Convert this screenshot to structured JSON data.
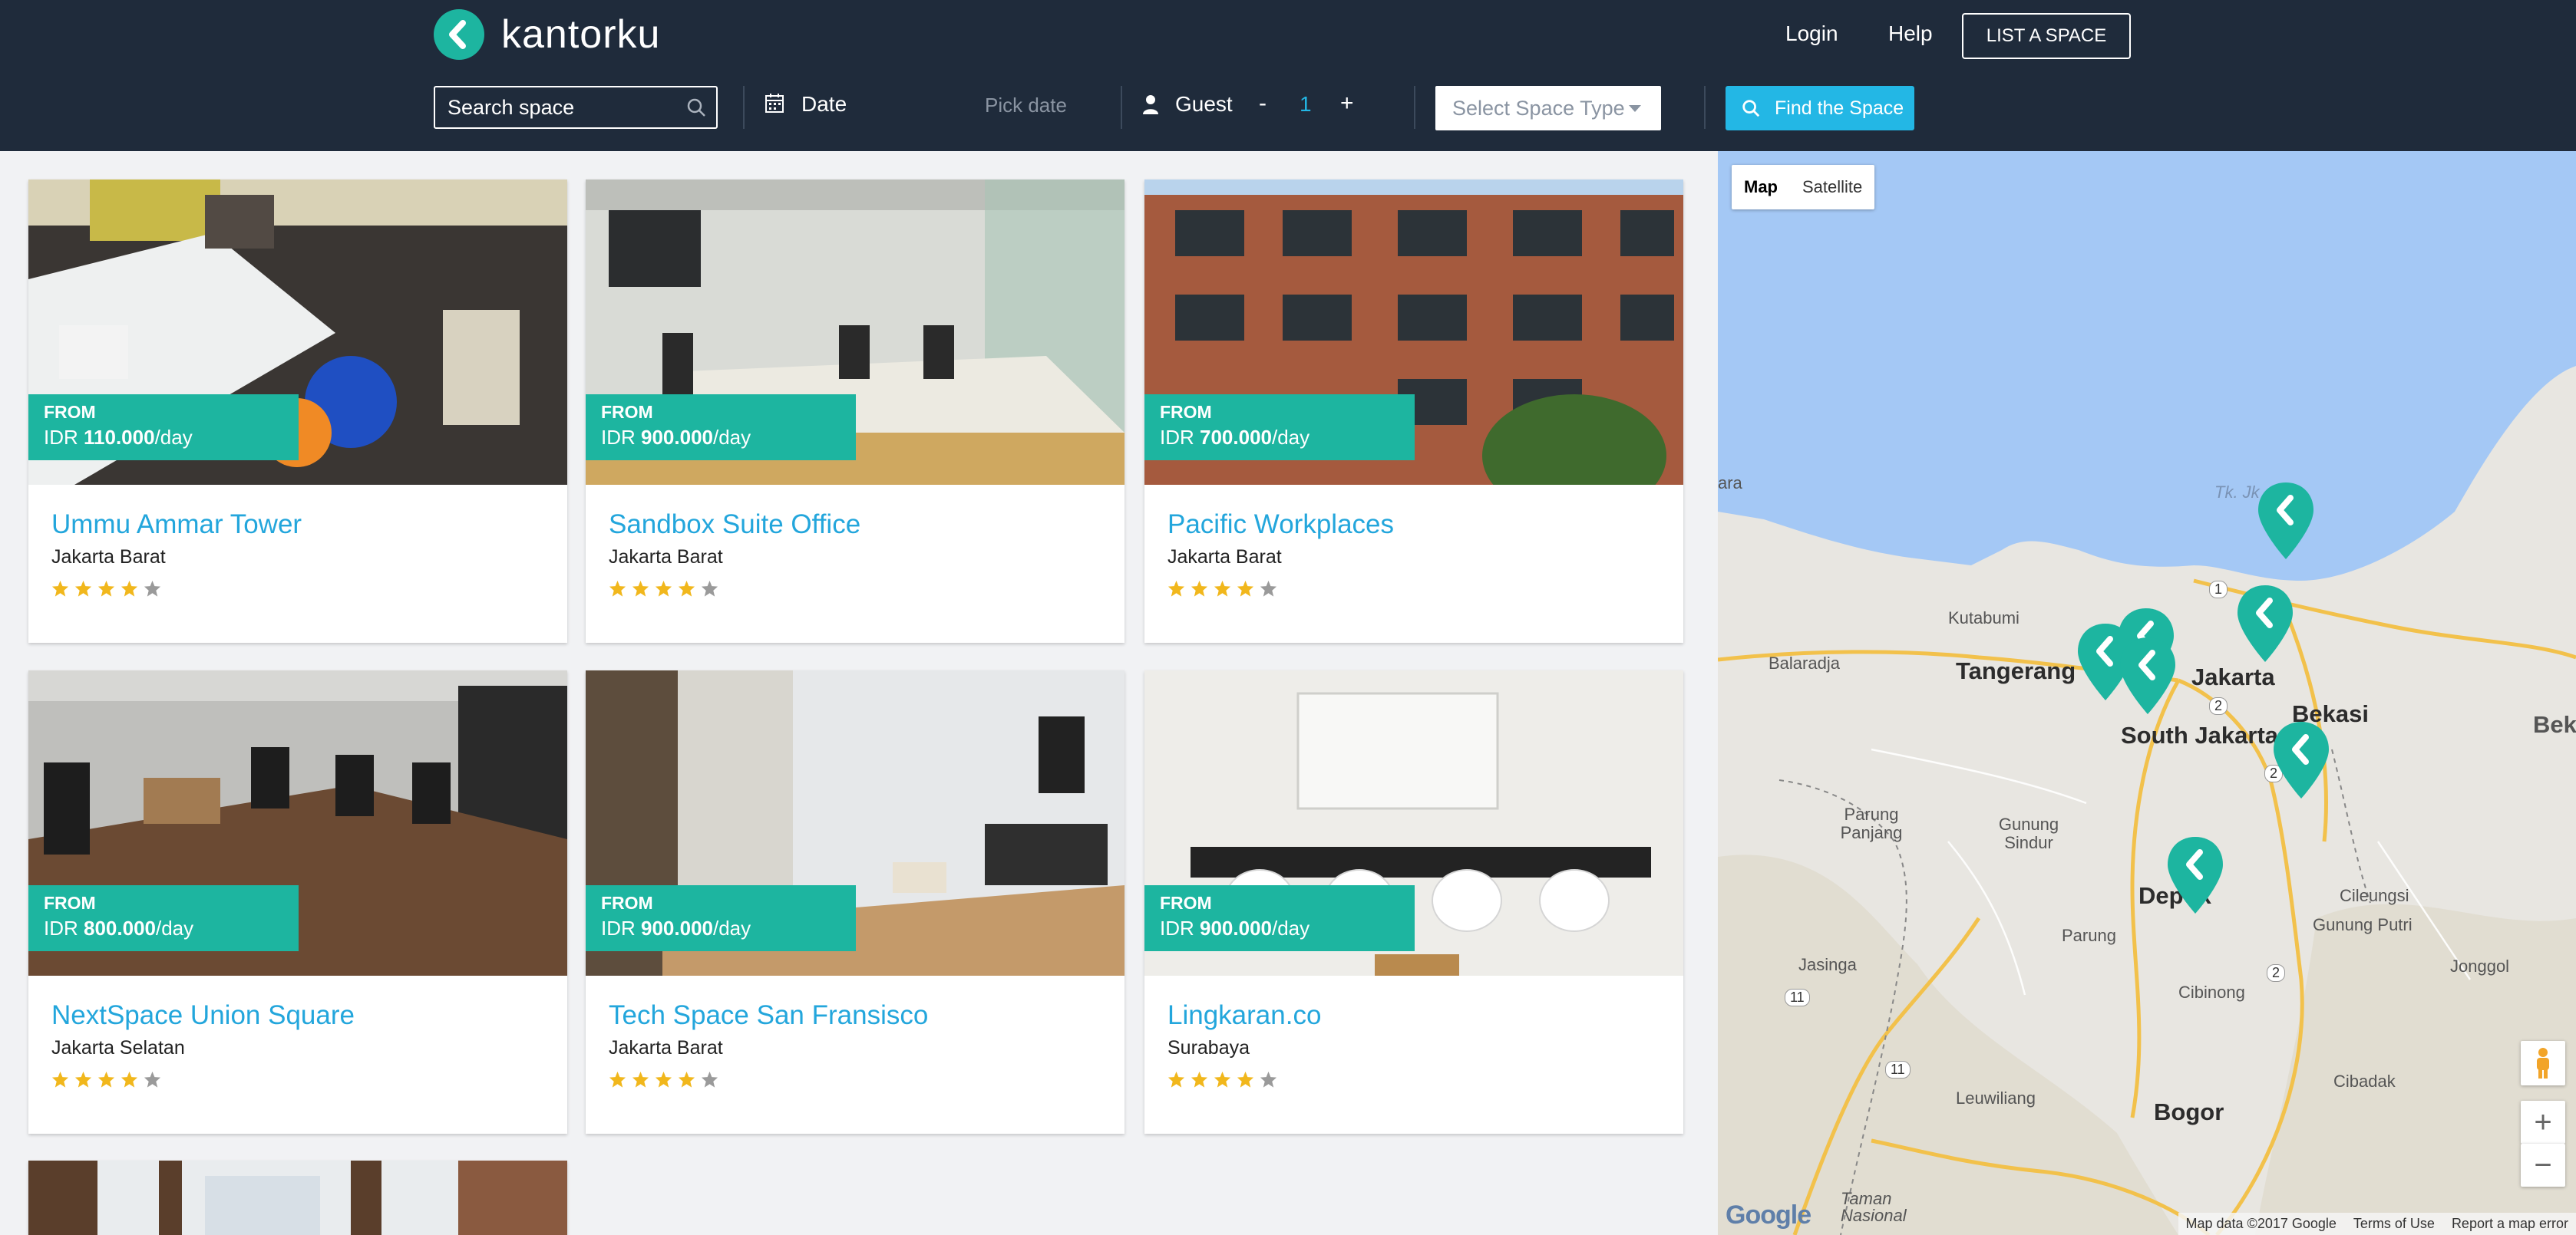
{
  "brand": {
    "name": "kantorku",
    "accent": "#1db5a0",
    "header_bg": "#1f2b3b",
    "link_color": "#23a6dc"
  },
  "nav": {
    "login": "Login",
    "help": "Help",
    "list_space": "LIST A SPACE"
  },
  "search": {
    "placeholder": "Search space",
    "date_label": "Date",
    "date_placeholder": "Pick date",
    "guest_label": "Guest",
    "guest_minus": "-",
    "guest_count": "1",
    "guest_plus": "+",
    "space_type_placeholder": "Select Space Type",
    "find_button": "Find the Space"
  },
  "listings": [
    {
      "from": "FROM",
      "currency": "IDR",
      "amount": "110.000",
      "unit": "/day",
      "name": "Ummu Ammar Tower",
      "location": "Jakarta Barat",
      "rating": 4,
      "rating_max": 5
    },
    {
      "from": "FROM",
      "currency": "IDR",
      "amount": "900.000",
      "unit": "/day",
      "name": "Sandbox Suite Office",
      "location": "Jakarta Barat",
      "rating": 4,
      "rating_max": 5
    },
    {
      "from": "FROM",
      "currency": "IDR",
      "amount": "700.000",
      "unit": "/day",
      "name": "Pacific Workplaces",
      "location": "Jakarta Barat",
      "rating": 4,
      "rating_max": 5
    },
    {
      "from": "FROM",
      "currency": "IDR",
      "amount": "800.000",
      "unit": "/day",
      "name": "NextSpace Union Square",
      "location": "Jakarta Selatan",
      "rating": 4,
      "rating_max": 5
    },
    {
      "from": "FROM",
      "currency": "IDR",
      "amount": "900.000",
      "unit": "/day",
      "name": "Tech Space San Fransisco",
      "location": "Jakarta Barat",
      "rating": 4,
      "rating_max": 5
    },
    {
      "from": "FROM",
      "currency": "IDR",
      "amount": "900.000",
      "unit": "/day",
      "name": "Lingkaran.co",
      "location": "Surabaya",
      "rating": 4,
      "rating_max": 5
    }
  ],
  "map": {
    "type_map": "Map",
    "type_satellite": "Satellite",
    "zoom_in": "+",
    "zoom_out": "−",
    "google": "Google",
    "attribution": "Map data ©2017 Google",
    "terms": "Terms of Use",
    "report": "Report a map error",
    "places": [
      "Tangerang",
      "Jakarta",
      "Bekasi",
      "South Jakarta",
      "Depok",
      "Bogor",
      "Kutabumi",
      "Balaradja",
      "Parung Panjang",
      "Gunung Sindur",
      "Parung",
      "Cileungsi",
      "Gunung Putri",
      "Cibinong",
      "Jonggol",
      "Jasinga",
      "Leuwiliang",
      "Cibadak",
      "Tk. Jk",
      "Bek",
      "Taman Nasional",
      "ara",
      "1",
      "2",
      "2",
      "2",
      "11",
      "11"
    ]
  }
}
